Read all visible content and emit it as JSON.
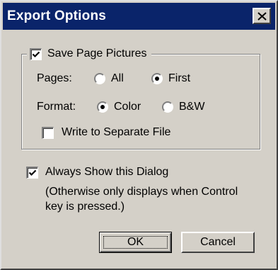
{
  "window": {
    "title": "Export Options",
    "close_icon": "close-icon"
  },
  "save_group": {
    "label": "Save Page Pictures",
    "checked": true,
    "pages": {
      "label": "Pages:",
      "options": [
        {
          "label": "All",
          "selected": false
        },
        {
          "label": "First",
          "selected": true
        }
      ]
    },
    "format": {
      "label": "Format:",
      "options": [
        {
          "label": "Color",
          "selected": true
        },
        {
          "label": "B&W",
          "selected": false
        }
      ]
    },
    "separate_file": {
      "label": "Write to Separate File",
      "checked": false
    }
  },
  "always_show": {
    "label": "Always Show this Dialog",
    "checked": true,
    "note_line1": "(Otherwise only displays when Control",
    "note_line2": "key is pressed.)"
  },
  "buttons": {
    "ok": "OK",
    "cancel": "Cancel"
  },
  "colors": {
    "titlebar": "#0a246a",
    "face": "#d4d0c8"
  }
}
